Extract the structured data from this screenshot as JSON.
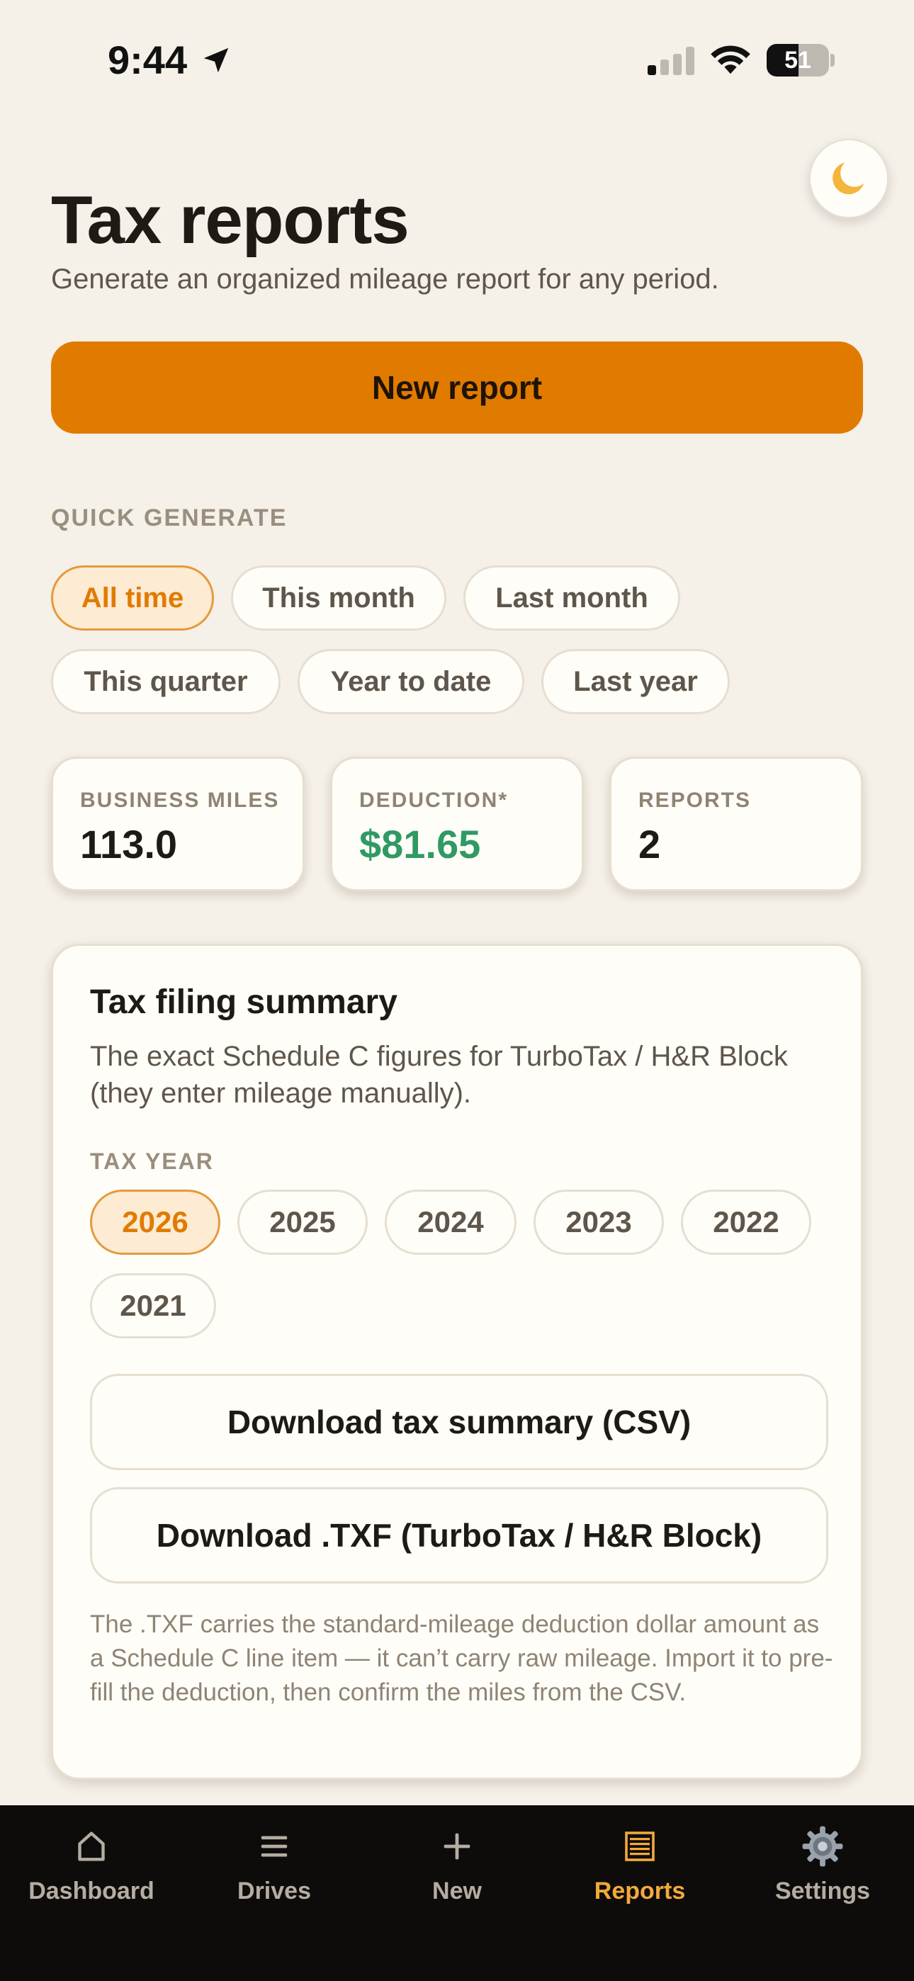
{
  "status_bar": {
    "time": "9:44",
    "battery_percent": 51,
    "battery_text": "51"
  },
  "theme_toggle": {
    "icon": "moon-icon"
  },
  "header": {
    "title": "Tax reports",
    "subtitle": "Generate an organized mileage report for any period."
  },
  "new_report": {
    "label": "New report"
  },
  "quick_generate": {
    "label": "QUICK GENERATE",
    "options": [
      "All time",
      "This month",
      "Last month",
      "This quarter",
      "Year to date",
      "Last year"
    ],
    "selected": "All time"
  },
  "stats": [
    {
      "label": "BUSINESS MILES",
      "value": "113.0"
    },
    {
      "label": "DEDUCTION*",
      "value": "$81.65"
    },
    {
      "label": "REPORTS",
      "value": "2"
    }
  ],
  "summary": {
    "title": "Tax filing summary",
    "description": "The exact Schedule C figures for TurboTax / H&R Block (they enter mileage manually).",
    "tax_year_label": "TAX YEAR",
    "years": [
      "2026",
      "2025",
      "2024",
      "2023",
      "2022",
      "2021"
    ],
    "selected_year": "2026",
    "csv_button": "Download tax summary (CSV)",
    "txf_button": "Download .TXF (TurboTax / H&R Block)",
    "note": "The .TXF carries the standard-mileage deduction dollar amount as a Schedule C line item — it can’t carry raw mileage. Import it to pre-fill the deduction, then confirm the miles from the CSV."
  },
  "tabs": [
    {
      "label": "Dashboard",
      "icon": "home-icon"
    },
    {
      "label": "Drives",
      "icon": "list-icon"
    },
    {
      "label": "New",
      "icon": "plus-icon"
    },
    {
      "label": "Reports",
      "icon": "report-icon"
    },
    {
      "label": "Settings",
      "icon": "gear-icon"
    }
  ],
  "active_tab": "Reports",
  "colors": {
    "accent": "#e07b00",
    "background": "#f5f0e8",
    "deduction_green": "#2f9a63",
    "tab_active": "#f2a93b"
  }
}
